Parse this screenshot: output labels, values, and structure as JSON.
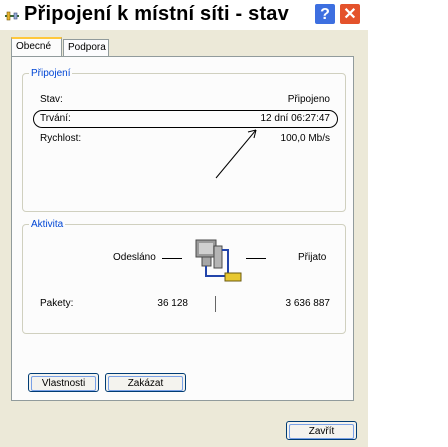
{
  "window": {
    "title": "Připojení k místní síti - stav",
    "help_label": "?",
    "close_label": "✕"
  },
  "tabs": [
    {
      "label": "Obecné"
    },
    {
      "label": "Podpora"
    }
  ],
  "connection": {
    "legend": "Připojení",
    "rows": [
      {
        "label": "Stav:",
        "value": "Připojeno"
      },
      {
        "label": "Trvání:",
        "value": "12 dní 06:27:47"
      },
      {
        "label": "Rychlost:",
        "value": "100,0 Mb/s"
      }
    ]
  },
  "activity": {
    "legend": "Aktivita",
    "sent_label": "Odesláno",
    "received_label": "Přijato",
    "packets_label": "Pakety:",
    "packets_sent": "36 128",
    "packets_received": "3 636 887"
  },
  "buttons": {
    "properties": "Vlastnosti",
    "disable": "Zakázat",
    "close": "Zavřít"
  },
  "icons": {
    "title": "network-connection-icon",
    "activity": "network-computers-icon"
  }
}
